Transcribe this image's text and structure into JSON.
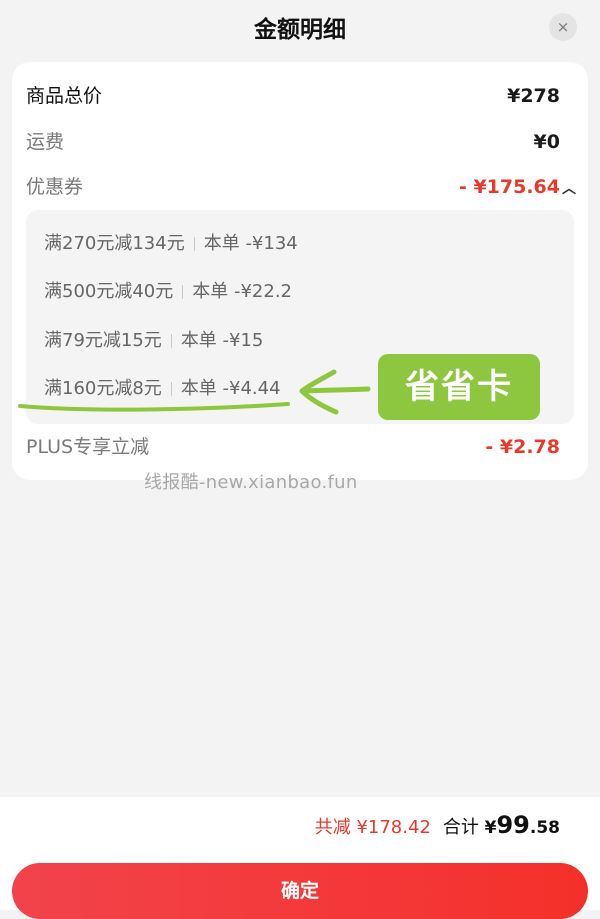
{
  "header": {
    "title": "金额明细",
    "close_symbol": "×"
  },
  "summary": {
    "items": [
      {
        "label": "商品总价",
        "value": "¥278"
      },
      {
        "label": "运费",
        "value": "¥0"
      },
      {
        "label": "优惠券",
        "value": "- ¥175.64"
      },
      {
        "label": "PLUS专享立减",
        "value": "- ¥2.78"
      }
    ]
  },
  "coupons": [
    {
      "condition": "满270元减134元",
      "amount": "本单 -¥134"
    },
    {
      "condition": "满500元减40元",
      "amount": "本单 -¥22.2"
    },
    {
      "condition": "满79元减15元",
      "amount": "本单 -¥15"
    },
    {
      "condition": "满160元减8元",
      "amount": "本单 -¥4.44"
    }
  ],
  "annotation": {
    "label": "省省卡",
    "color": "#8dc63f"
  },
  "watermark": "线报酷-new.xianbao.fun",
  "footer": {
    "total_reduce": "共减 ¥178.42",
    "total_label": "合计",
    "currency": "¥",
    "total_integer": "99",
    "total_decimal": ".58",
    "confirm_label": "确定"
  },
  "colors": {
    "accent_red": "#e8392c",
    "button_red": "#f2434b",
    "annotation_green": "#8dc63f"
  }
}
